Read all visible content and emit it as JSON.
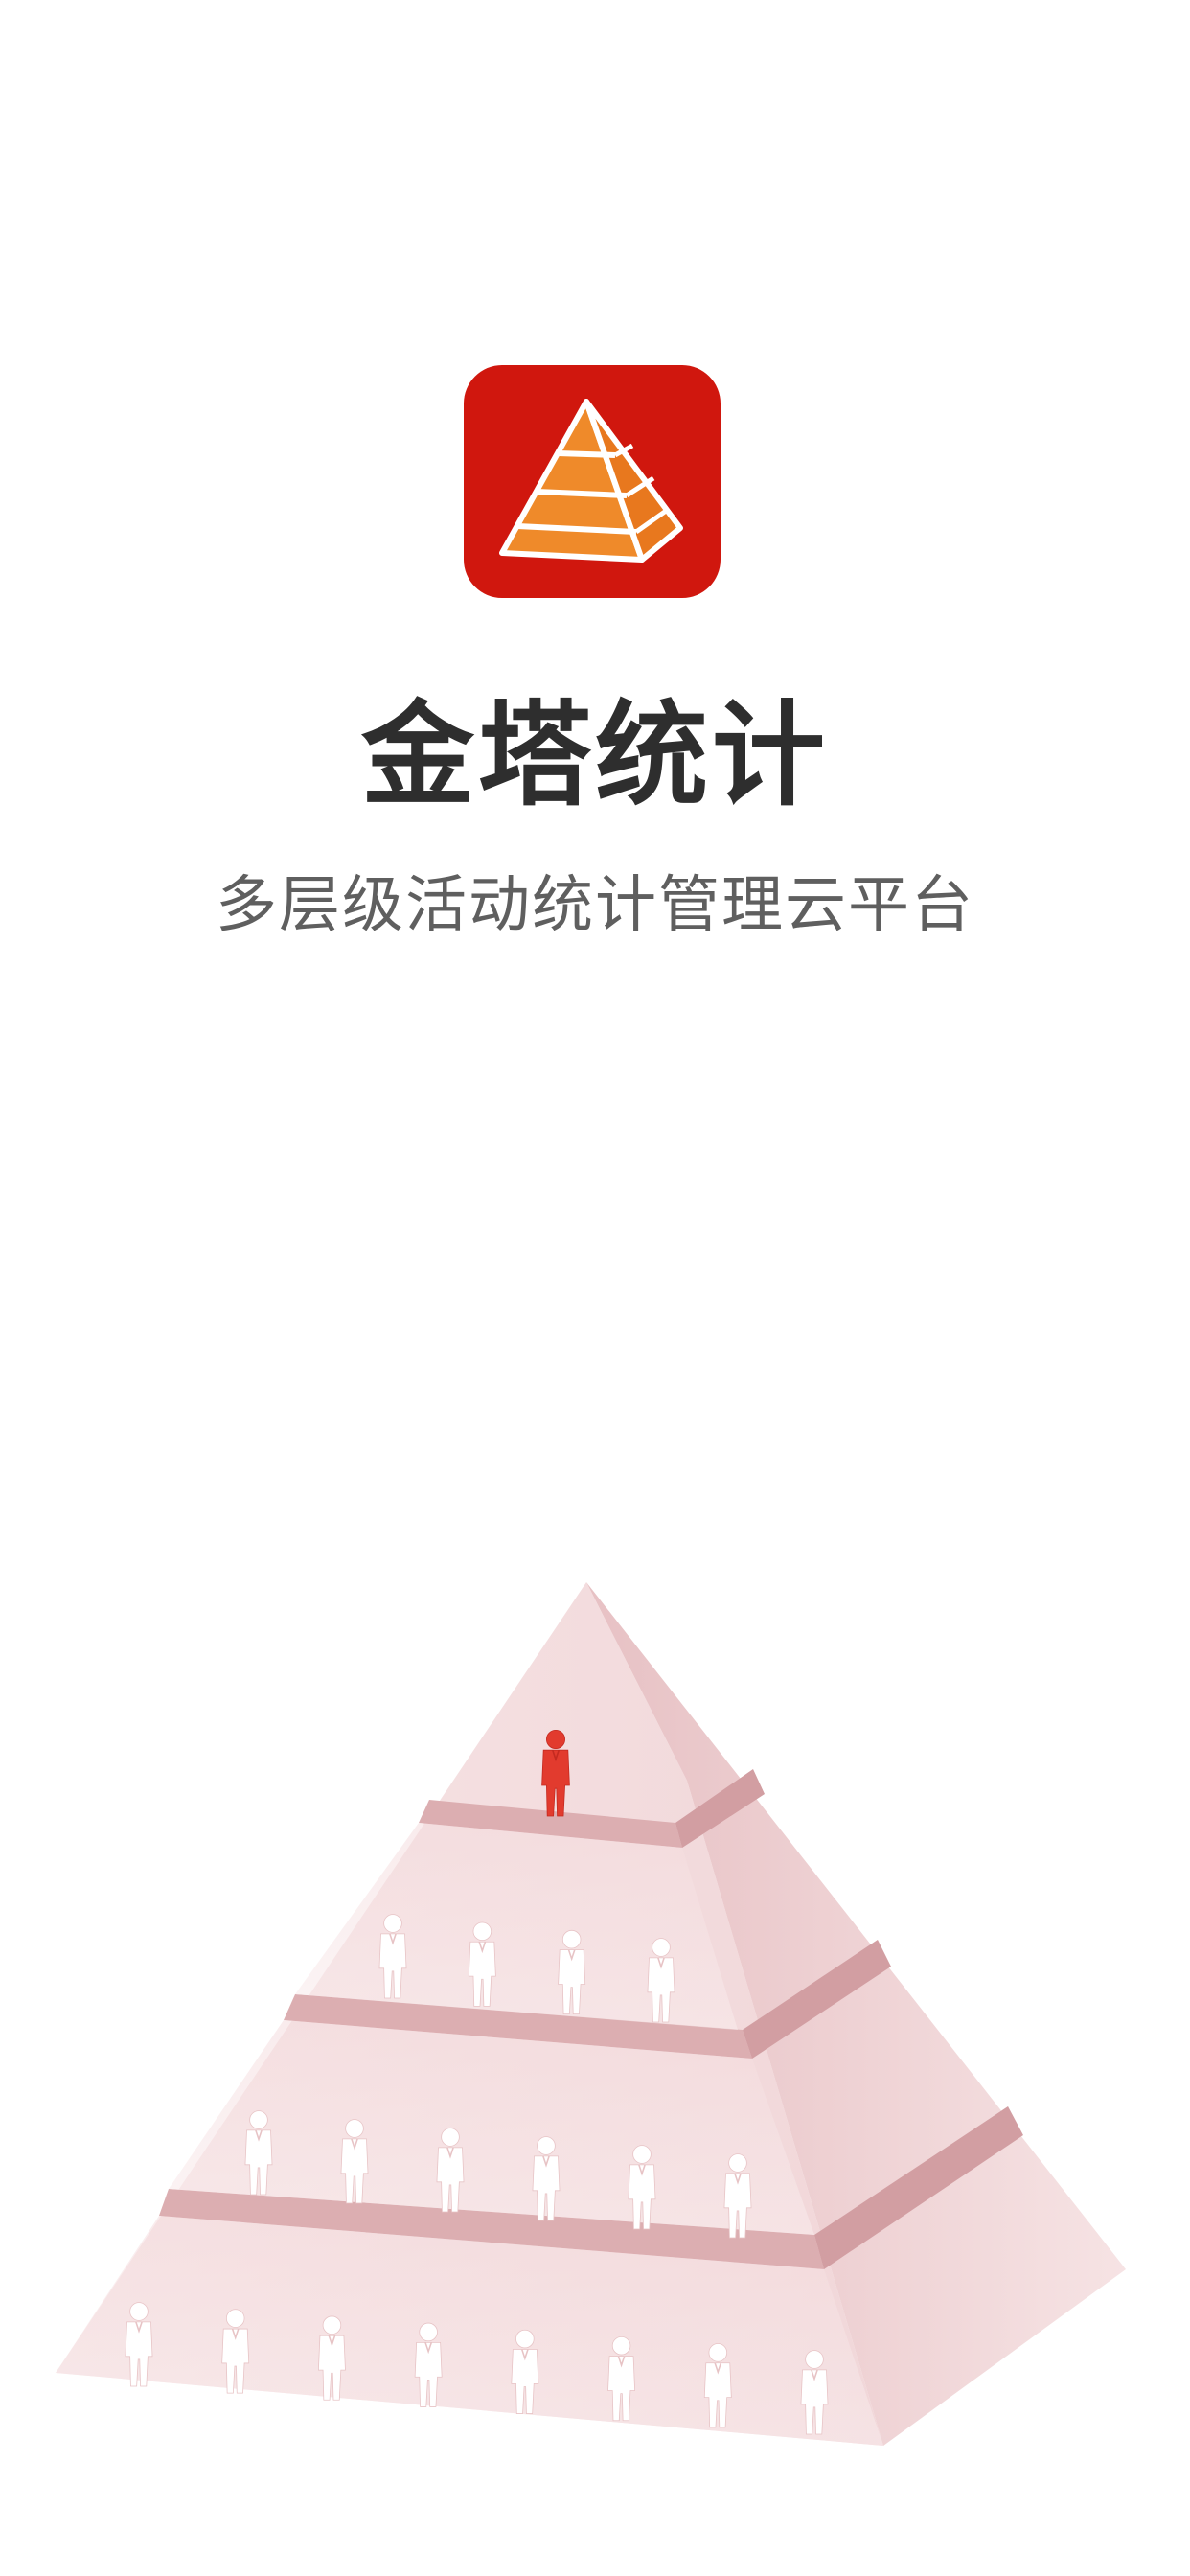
{
  "splash": {
    "app_name": "金塔统计",
    "tagline": "多层级活动统计管理云平台",
    "icon": "pyramid-logo-icon",
    "illustration": "pyramid-hierarchy-people"
  },
  "colors": {
    "logo_background": "#d0170e",
    "logo_pyramid": "#ef8a2a",
    "title_text": "#2e2e2e",
    "subtitle_text": "#5f5f5f",
    "pyramid_light": "#f6e1e2",
    "pyramid_dark": "#e2b7b9",
    "leader_figure": "#e23b2e",
    "member_figure": "#ffffff"
  },
  "pyramid": {
    "tiers": [
      {
        "people": 1,
        "highlight": true
      },
      {
        "people": 4,
        "highlight": false
      },
      {
        "people": 6,
        "highlight": false
      },
      {
        "people": 8,
        "highlight": false
      }
    ]
  }
}
